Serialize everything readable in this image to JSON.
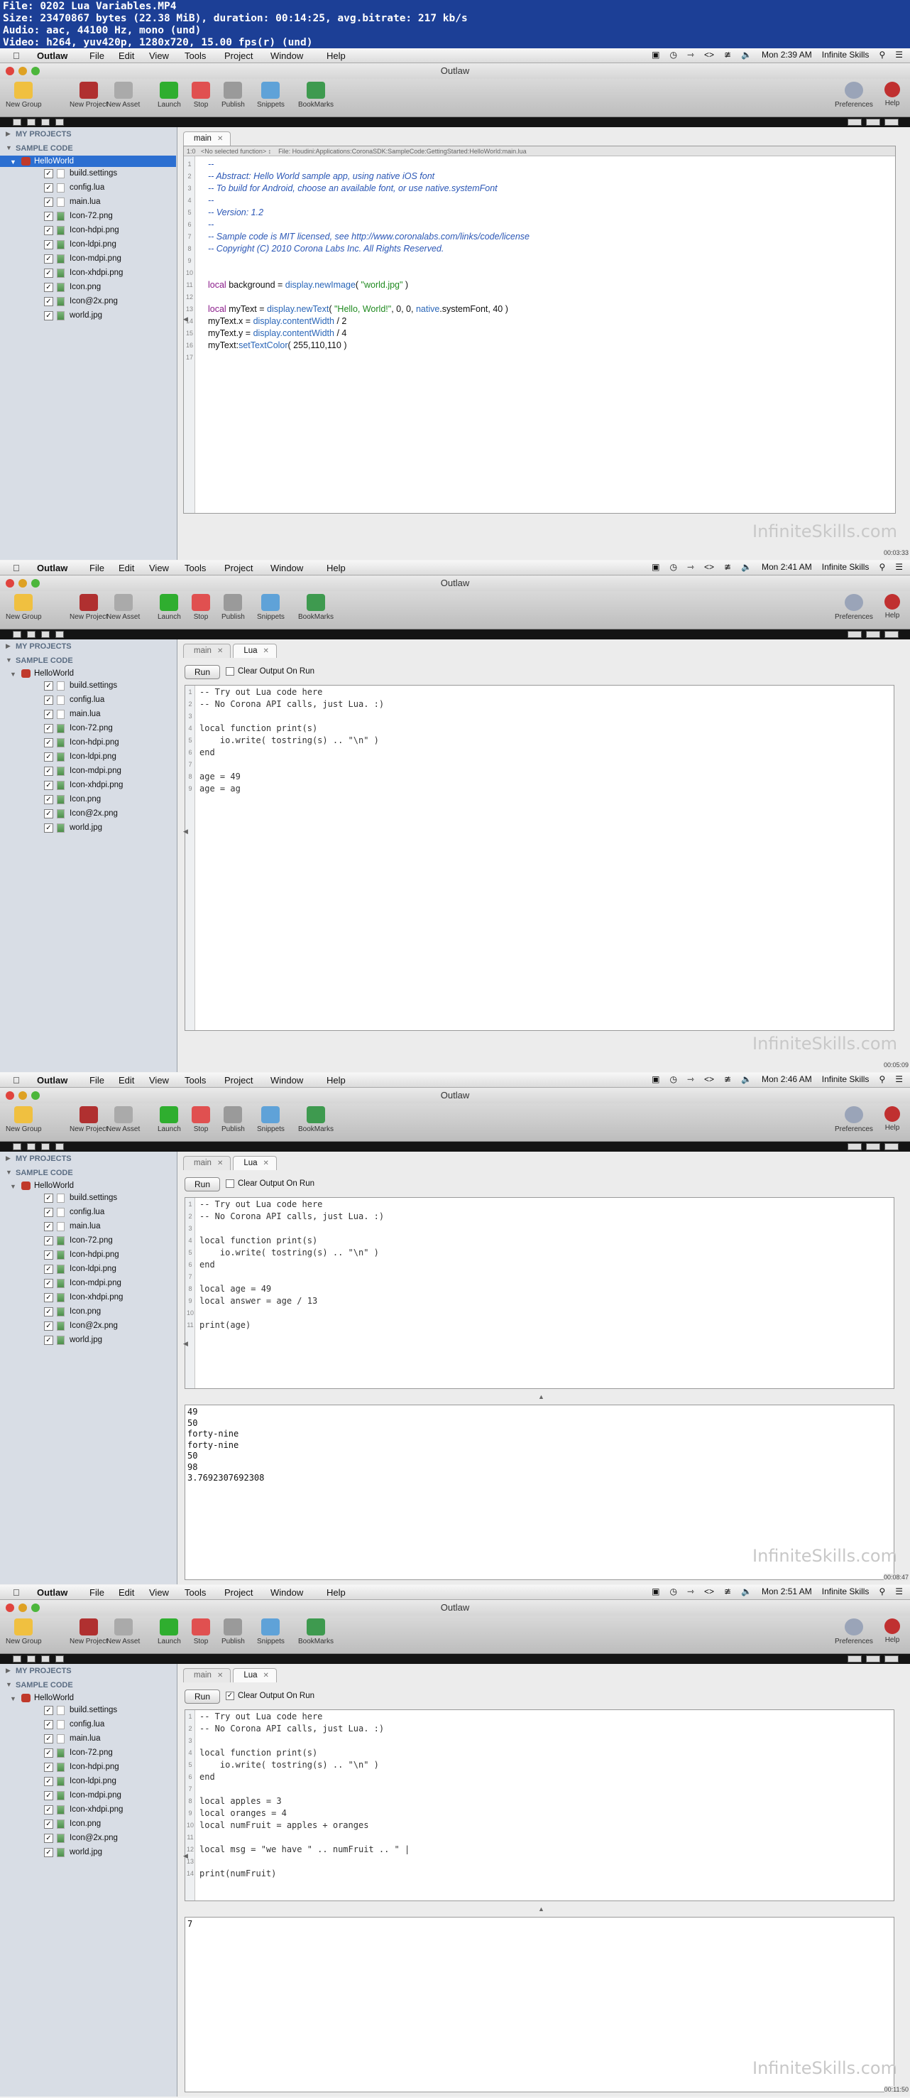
{
  "info": {
    "line1": "File: 0202 Lua Variables.MP4",
    "line2": "Size: 23470867 bytes (22.38 MiB), duration: 00:14:25, avg.bitrate: 217 kb/s",
    "line3": "Audio: aac, 44100 Hz, mono (und)",
    "line4": "Video: h264, yuv420p, 1280x720, 15.00 fps(r) (und)"
  },
  "app": {
    "window_title": "Outlaw",
    "menu": [
      "Outlaw",
      "File",
      "Edit",
      "View",
      "Tools",
      "Project",
      "Window",
      "Help"
    ],
    "user": "Infinite Skills",
    "toolbar": {
      "new_group": "New Group",
      "new_project": "New Project",
      "new_asset": "New Asset",
      "launch": "Launch",
      "stop": "Stop",
      "publish": "Publish",
      "snippets": "Snippets",
      "bookmarks": "BookMarks",
      "preferences": "Preferences",
      "help": "Help"
    },
    "sidebar": {
      "my_projects": "MY PROJECTS",
      "sample_code": "SAMPLE CODE",
      "project": "HelloWorld",
      "files": [
        {
          "name": "build.settings",
          "type": "doc"
        },
        {
          "name": "config.lua",
          "type": "doc"
        },
        {
          "name": "main.lua",
          "type": "doc"
        },
        {
          "name": "Icon-72.png",
          "type": "img"
        },
        {
          "name": "Icon-hdpi.png",
          "type": "img"
        },
        {
          "name": "Icon-ldpi.png",
          "type": "img"
        },
        {
          "name": "Icon-mdpi.png",
          "type": "img"
        },
        {
          "name": "Icon-xhdpi.png",
          "type": "img"
        },
        {
          "name": "Icon.png",
          "type": "img"
        },
        {
          "name": "Icon@2x.png",
          "type": "img"
        },
        {
          "name": "world.jpg",
          "type": "img"
        }
      ]
    },
    "tabs": {
      "main": "main",
      "lua": "Lua"
    },
    "run_label": "Run",
    "clear_label": "Clear Output On Run",
    "watermark": "InfiniteSkills.com"
  },
  "frames": [
    {
      "time": "Mon 2:39 AM",
      "timecode": "00:03:33",
      "crumb_line": "1:0",
      "crumb_func": "<No selected function> ↕",
      "crumb_file": "File: Houdini:Applications:CoronaSDK:SampleCode:GettingStarted:HelloWorld:main.lua",
      "code": [
        "--",
        "-- Abstract: Hello World sample app, using native iOS font",
        "-- To build for Android, choose an available font, or use native.systemFont",
        "--",
        "-- Version: 1.2",
        "--",
        "-- Sample code is MIT licensed, see http://www.coronalabs.com/links/code/license",
        "-- Copyright (C) 2010 Corona Labs Inc. All Rights Reserved.",
        "",
        "",
        "local background = display.newImage( \"world.jpg\" )",
        "",
        "local myText = display.newText( \"Hello, World!\", 0, 0, native.systemFont, 40 )",
        "myText.x = display.contentWidth / 2",
        "myText.y = display.contentWidth / 4",
        "myText:setTextColor( 255,110,110 )",
        ""
      ]
    },
    {
      "time": "Mon 2:41 AM",
      "timecode": "00:05:09",
      "clear_checked": false,
      "code": [
        "-- Try out Lua code here",
        "-- No Corona API calls, just Lua. :)",
        "",
        "local function print(s)",
        "    io.write( tostring(s) .. \"\\n\" )",
        "end",
        "",
        "age = 49",
        "age = ag"
      ],
      "output": []
    },
    {
      "time": "Mon 2:46 AM",
      "timecode": "00:08:47",
      "clear_checked": false,
      "code": [
        "-- Try out Lua code here",
        "-- No Corona API calls, just Lua. :)",
        "",
        "local function print(s)",
        "    io.write( tostring(s) .. \"\\n\" )",
        "end",
        "",
        "local age = 49",
        "local answer = age / 13",
        "",
        "print(age)"
      ],
      "output": [
        "49",
        "50",
        "forty-nine",
        "forty-nine",
        "50",
        "98",
        "3.7692307692308"
      ]
    },
    {
      "time": "Mon 2:51 AM",
      "timecode": "00:11:50",
      "clear_checked": true,
      "code": [
        "-- Try out Lua code here",
        "-- No Corona API calls, just Lua. :)",
        "",
        "local function print(s)",
        "    io.write( tostring(s) .. \"\\n\" )",
        "end",
        "",
        "local apples = 3",
        "local oranges = 4",
        "local numFruit = apples + oranges",
        "",
        "local msg = \"we have \" .. numFruit .. \" |",
        "",
        "print(numFruit)"
      ],
      "output": [
        "7"
      ]
    }
  ]
}
